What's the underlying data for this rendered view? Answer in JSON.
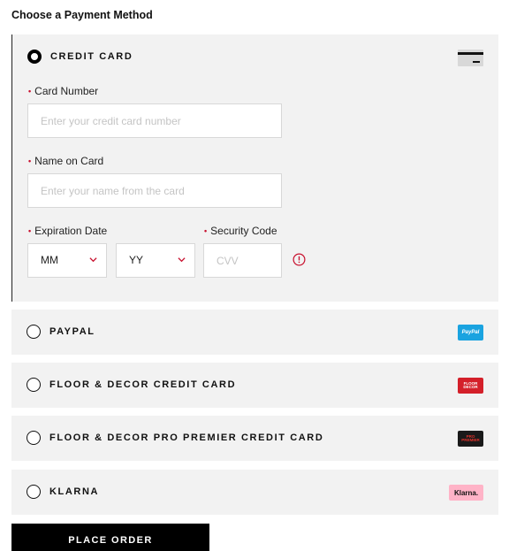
{
  "page": {
    "title": "Choose a Payment Method"
  },
  "methods": {
    "credit_card": {
      "label": "CREDIT CARD",
      "selected": true,
      "icon": "credit-card-icon"
    },
    "paypal": {
      "label": "PAYPAL",
      "logo_text": "PayPal",
      "logo_color": "#1aa3e0"
    },
    "fd_credit": {
      "label": "FLOOR & DECOR CREDIT CARD",
      "logo_text": "FLOOR DECOR",
      "logo_color": "#d4202a"
    },
    "fd_pro": {
      "label": "FLOOR & DECOR PRO PREMIER CREDIT CARD",
      "logo_text": "PRO PREMIER",
      "logo_color": "#1a1a1a"
    },
    "klarna": {
      "label": "KLARNA",
      "logo_text": "Klarna.",
      "logo_color": "#ffb3c7"
    }
  },
  "form": {
    "card_number": {
      "label": "Card Number",
      "placeholder": "Enter your credit card number"
    },
    "name_on_card": {
      "label": "Name on Card",
      "placeholder": "Enter your name from the card"
    },
    "expiration": {
      "label": "Expiration Date",
      "month": "MM",
      "year": "YY"
    },
    "security_code": {
      "label": "Security Code",
      "placeholder": "CVV"
    },
    "required_mark": "•"
  },
  "actions": {
    "place_order": "PLACE ORDER"
  },
  "colors": {
    "accent_red": "#c8102e",
    "panel_bg": "#f2f2f2",
    "button_bg": "#000000"
  }
}
